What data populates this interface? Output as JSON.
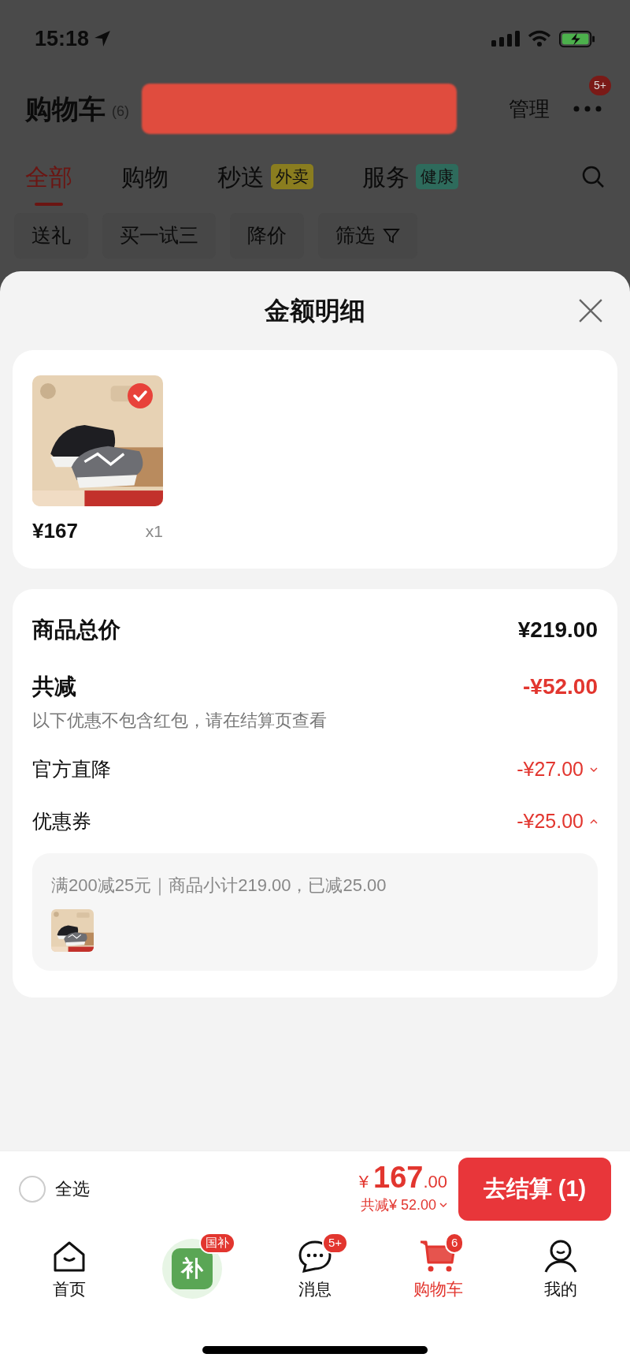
{
  "status_bar": {
    "time": "15:18"
  },
  "header": {
    "title": "购物车",
    "count": "(6)",
    "manage": "管理",
    "more_badge": "5+"
  },
  "tabs": [
    {
      "label": "全部",
      "selected": true
    },
    {
      "label": "购物",
      "selected": false
    },
    {
      "label": "秒送",
      "selected": false,
      "tag": {
        "label": "外卖",
        "color": "#8a7d1f"
      }
    },
    {
      "label": "服务",
      "selected": false,
      "tag": {
        "label": "健康",
        "color": "#2e6b5c"
      }
    }
  ],
  "chips": [
    {
      "label": "送礼",
      "kind": "plain"
    },
    {
      "label": "买一试三",
      "kind": "plain"
    },
    {
      "label": "降价",
      "kind": "plain"
    },
    {
      "label": "筛选",
      "kind": "filter"
    }
  ],
  "sheet": {
    "title": "金额明细",
    "items": [
      {
        "kind": "picture",
        "price": "¥167",
        "quantity": "x1",
        "checked": true
      }
    ],
    "total": {
      "label": "商品总价",
      "value": "¥219.00"
    },
    "reduction": {
      "label": "共减",
      "value": "-¥52.00",
      "note": "以下优惠不包含红包，请在结算页查看"
    },
    "discounts": [
      {
        "label": "官方直降",
        "value": "-¥27.00",
        "expanded": false
      },
      {
        "label": "优惠券",
        "value": "-¥25.00",
        "expanded": true,
        "detail": "满200减25元｜商品小计219.00，已减25.00"
      }
    ]
  },
  "checkout": {
    "select_all": {
      "label": "全选",
      "checked": false
    },
    "currency": "¥",
    "amount": "167",
    "decimals": ".00",
    "saved": "共减¥ 52.00",
    "button": "去结算 (1)"
  },
  "nav": [
    {
      "kind": "home",
      "label": "首页",
      "selected": false
    },
    {
      "kind": "subsidy",
      "glyph": "补",
      "badge": "国补",
      "selected": false
    },
    {
      "kind": "message",
      "label": "消息",
      "badge": "5+",
      "selected": false
    },
    {
      "kind": "cart",
      "label": "购物车",
      "badge": "6",
      "selected": true
    },
    {
      "kind": "profile",
      "label": "我的",
      "selected": false
    }
  ]
}
